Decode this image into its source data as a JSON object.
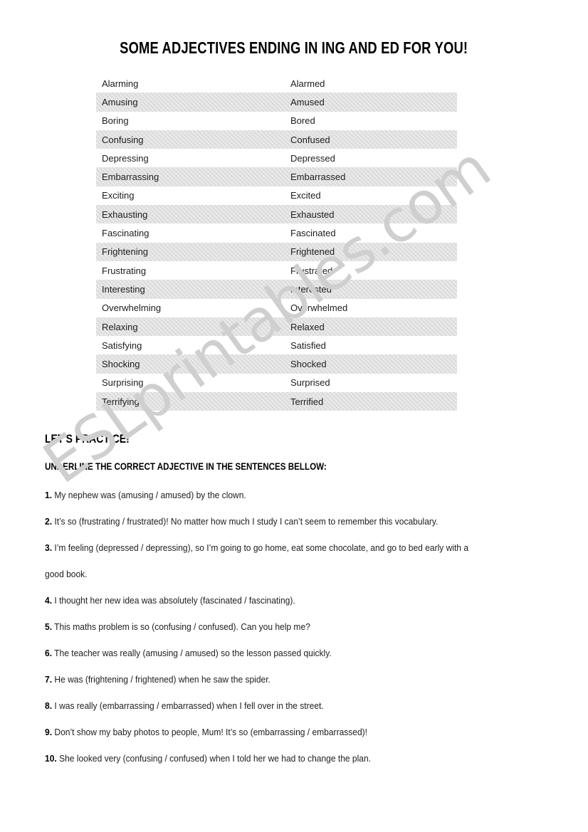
{
  "document": {
    "title": "SOME ADJECTIVES ENDING IN ING AND ED FOR YOU!",
    "watermark": "ESLprintables.com",
    "colors": {
      "row_shade": "#dedede",
      "text": "#1d1d1d",
      "heading": "#000000",
      "watermark": "#cfcfcf"
    }
  },
  "adjectives_table": {
    "rows": [
      {
        "ing": "Alarming",
        "ed": "Alarmed",
        "shaded": false
      },
      {
        "ing": "Amusing",
        "ed": "Amused",
        "shaded": true
      },
      {
        "ing": "Boring",
        "ed": "Bored",
        "shaded": false
      },
      {
        "ing": "Confusing",
        "ed": "Confused",
        "shaded": true
      },
      {
        "ing": "Depressing",
        "ed": "Depressed",
        "shaded": false
      },
      {
        "ing": "Embarrassing",
        "ed": "Embarrassed",
        "shaded": true
      },
      {
        "ing": "Exciting",
        "ed": "Excited",
        "shaded": false
      },
      {
        "ing": "Exhausting",
        "ed": "Exhausted",
        "shaded": true
      },
      {
        "ing": "Fascinating",
        "ed": "Fascinated",
        "shaded": false
      },
      {
        "ing": "Frightening",
        "ed": "Frightened",
        "shaded": true
      },
      {
        "ing": "Frustrating",
        "ed": "Frustrated",
        "shaded": false
      },
      {
        "ing": "Interesting",
        "ed": "Interested",
        "shaded": true
      },
      {
        "ing": "Overwhelming",
        "ed": "Overwhelmed",
        "shaded": false
      },
      {
        "ing": "Relaxing",
        "ed": "Relaxed",
        "shaded": true
      },
      {
        "ing": "Satisfying",
        "ed": "Satisfied",
        "shaded": false
      },
      {
        "ing": "Shocking",
        "ed": "Shocked",
        "shaded": true
      },
      {
        "ing": "Surprising",
        "ed": "Surprised",
        "shaded": false
      },
      {
        "ing": "Terrifying",
        "ed": "Terrified",
        "shaded": true
      }
    ]
  },
  "practice": {
    "heading": "LET'S PRACTICE!",
    "instruction": "UNDERLINE THE CORRECT ADJECTIVE IN THE SENTENCES BELLOW:",
    "questions": [
      {
        "num": "1.",
        "text": "My nephew was (amusing / amused) by the clown."
      },
      {
        "num": "2.",
        "text": "It’s so (frustrating / frustrated)! No matter how much I study I can’t seem to remember this vocabulary."
      },
      {
        "num": "3.",
        "text": "I’m feeling (depressed / depressing), so I’m going to go home, eat some chocolate, and go to bed early with a good book."
      },
      {
        "num": "4.",
        "text": "I thought her new idea was absolutely (fascinated / fascinating)."
      },
      {
        "num": "5.",
        "text": "This maths problem is so (confusing / confused). Can you help me?"
      },
      {
        "num": "6.",
        "text": "The teacher was really (amusing / amused) so the lesson passed quickly."
      },
      {
        "num": "7.",
        "text": "He was (frightening / frightened) when he saw the spider."
      },
      {
        "num": "8.",
        "text": "I was really (embarrassing / embarrassed) when I fell over in the street."
      },
      {
        "num": "9.",
        "text": "Don’t show my baby photos to people, Mum! It’s so (embarrassing / embarrassed)!"
      },
      {
        "num": "10.",
        "text": "She looked very (confusing / confused) when I told her we had to change the plan."
      }
    ]
  }
}
